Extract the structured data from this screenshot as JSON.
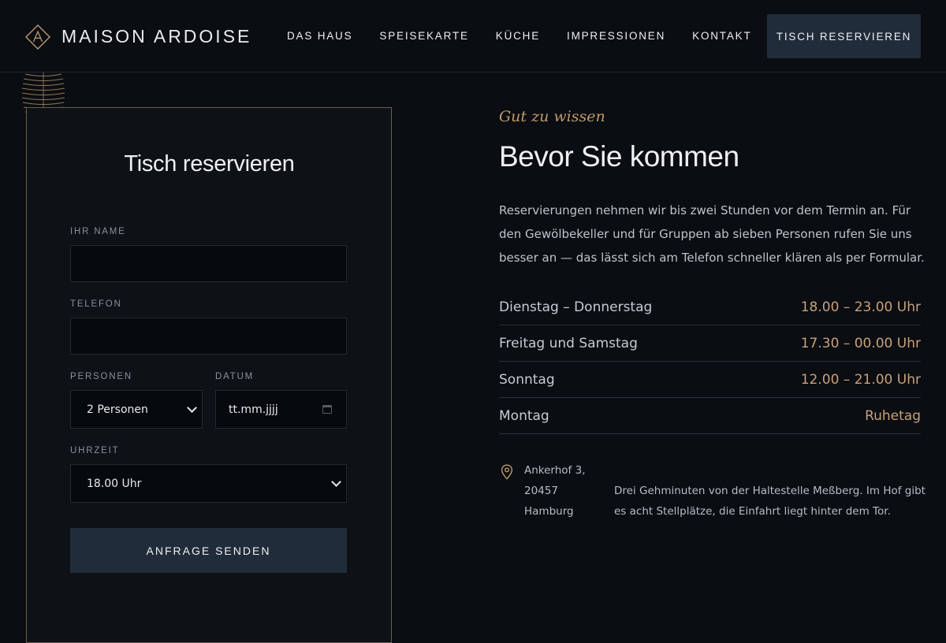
{
  "brand": {
    "name": "MAISON ARDOISE",
    "accent_color": "#c09a6d",
    "logo_icon": "diamond-a-monogram-icon"
  },
  "nav": {
    "items": [
      {
        "label": "DAS HAUS"
      },
      {
        "label": "SPEISEKARTE"
      },
      {
        "label": "KÜCHE"
      },
      {
        "label": "IMPRESSIONEN"
      },
      {
        "label": "KONTAKT"
      }
    ],
    "cta_label": "TISCH RESERVIEREN"
  },
  "form": {
    "title": "Tisch reservieren",
    "name_label": "IHR NAME",
    "name_value": "",
    "phone_label": "TELEFON",
    "phone_value": "",
    "persons_label": "PERSONEN",
    "persons_value": "2 Personen",
    "date_label": "DATUM",
    "date_value": "tt.mm.jjjj",
    "time_label": "UHRZEIT",
    "time_value": "18.00 Uhr",
    "submit_label": "ANFRAGE SENDEN"
  },
  "info": {
    "eyebrow": "Gut zu wissen",
    "heading": "Bevor Sie kommen",
    "intro": "Reservierungen nehmen wir bis zwei Stunden vor dem Termin an. Für den Gewölbekeller und für Gruppen ab sieben Personen rufen Sie uns besser an — das lässt sich am Telefon schneller klären als per Formular.",
    "hours": [
      {
        "day": "Dienstag – Donnerstag",
        "time": "18.00 – 23.00 Uhr"
      },
      {
        "day": "Freitag und Samstag",
        "time": "17.30 – 00.00 Uhr"
      },
      {
        "day": "Sonntag",
        "time": "12.00 – 21.00 Uhr"
      },
      {
        "day": "Montag",
        "time": "Ruhetag"
      }
    ],
    "address_lines": [
      "Ankerhof 3,",
      "20457",
      "Hamburg"
    ],
    "directions": "Drei Gehminuten von der Haltestelle Meßberg. Im Hof gibt es acht Stellplätze, die Einfahrt liegt hinter dem Tor.",
    "pin_icon": "map-pin-icon"
  }
}
